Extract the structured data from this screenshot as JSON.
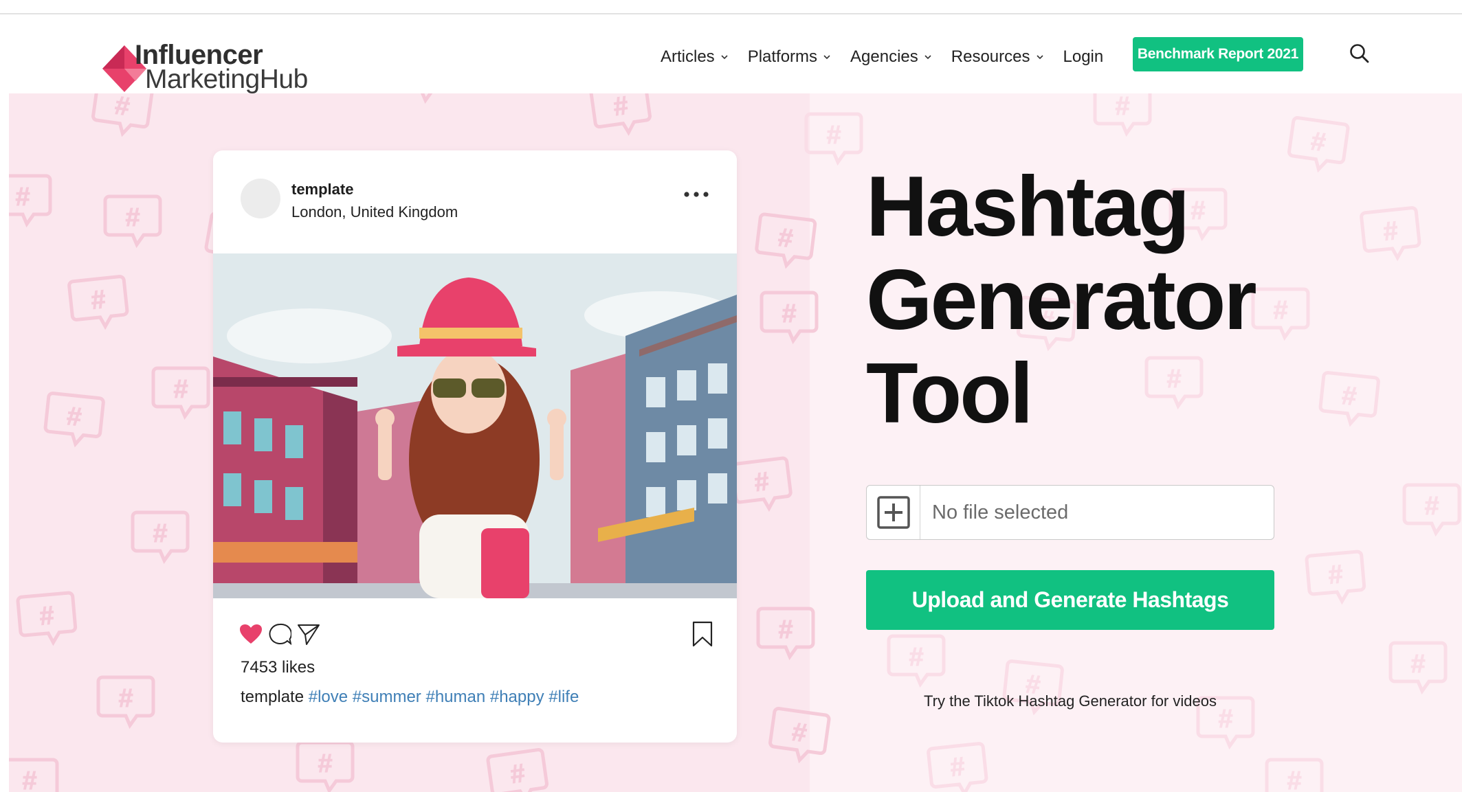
{
  "brand": {
    "line1": "Influencer",
    "line2": "MarketingHub",
    "colors": {
      "pink": "#e8416b",
      "pink_dark": "#c92a55",
      "green": "#11c181"
    }
  },
  "nav": {
    "items": [
      {
        "label": "Articles",
        "icon": "chevron-down-icon"
      },
      {
        "label": "Platforms",
        "icon": "chevron-down-icon"
      },
      {
        "label": "Agencies",
        "icon": "chevron-down-icon"
      },
      {
        "label": "Resources",
        "icon": "chevron-down-icon"
      }
    ],
    "login": "Login",
    "cta": "Benchmark Report 2021",
    "search_icon": "search-icon"
  },
  "post": {
    "username": "template",
    "location": "London, United Kingdom",
    "more_icon": "more-options-icon",
    "actions": [
      "heart-icon",
      "comment-icon",
      "share-icon",
      "bookmark-icon"
    ],
    "likes": "7453 likes",
    "caption_user": "template",
    "hashtags": "#love #summer #human #happy #life"
  },
  "tool": {
    "title_lines": [
      "Hashtag",
      "Generator",
      "Tool"
    ],
    "file_placeholder": "No file selected",
    "upload_label": "Upload and Generate Hashtags",
    "tiktok_link": "Try the Tiktok Hashtag Generator for videos"
  }
}
